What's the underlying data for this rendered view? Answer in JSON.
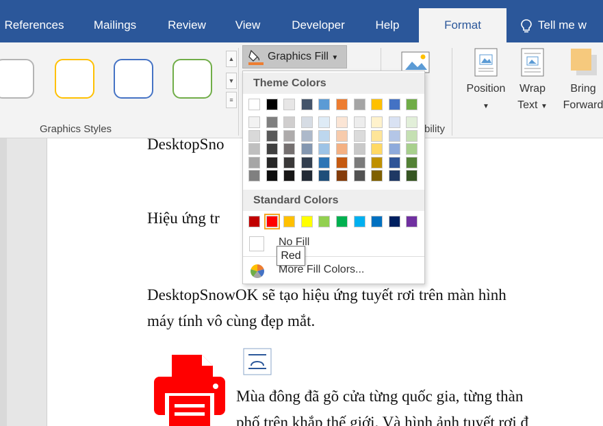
{
  "tabs": [
    {
      "label": "References"
    },
    {
      "label": "Mailings"
    },
    {
      "label": "Review"
    },
    {
      "label": "View"
    },
    {
      "label": "Developer"
    },
    {
      "label": "Help"
    },
    {
      "label": "Format"
    }
  ],
  "tell_me": "Tell me w",
  "ribbon": {
    "graphics_styles_label": "Graphics Styles",
    "graphics_fill_label": "Graphics Fill",
    "position_label": "Position",
    "wrap_text_label1": "Wrap",
    "wrap_text_label2": "Text",
    "bring_forward_label1": "Bring",
    "bring_forward_label2": "Forward",
    "accessibility_fragment": "bility",
    "shape_style_colors": [
      "#b4b4b4",
      "#ffc000",
      "#4472c4",
      "#70ad47"
    ]
  },
  "dropdown": {
    "theme_colors_heading": "Theme Colors",
    "standard_colors_heading": "Standard Colors",
    "no_fill_label": "No Fill",
    "more_fill_label": "More Fill Colors...",
    "theme_top_row": [
      "#ffffff",
      "#000000",
      "#e7e6e6",
      "#44546a",
      "#5b9bd5",
      "#ed7d31",
      "#a5a5a5",
      "#ffc000",
      "#4472c4",
      "#70ad47"
    ],
    "theme_shades": [
      [
        "#f2f2f2",
        "#d9d9d9",
        "#bfbfbf",
        "#a6a6a6",
        "#808080"
      ],
      [
        "#7f7f7f",
        "#595959",
        "#404040",
        "#262626",
        "#0d0d0d"
      ],
      [
        "#d0cece",
        "#aeabab",
        "#757070",
        "#3a3838",
        "#171616"
      ],
      [
        "#d6dce4",
        "#adb9ca",
        "#8497b0",
        "#333f4f",
        "#222a35"
      ],
      [
        "#deebf6",
        "#bdd7ee",
        "#9dc3e6",
        "#2e75b5",
        "#1f4e79"
      ],
      [
        "#fbe5d5",
        "#f7cbac",
        "#f4b183",
        "#c55a11",
        "#843c0b"
      ],
      [
        "#ededed",
        "#dbdbdb",
        "#c9c9c9",
        "#7b7b7b",
        "#525252"
      ],
      [
        "#fff2cc",
        "#fee599",
        "#ffd965",
        "#bf9000",
        "#7f6000"
      ],
      [
        "#d9e2f3",
        "#b4c6e7",
        "#8eaadb",
        "#2f5496",
        "#1f3864"
      ],
      [
        "#e2efd9",
        "#c5e0b3",
        "#a8d08d",
        "#538135",
        "#375623"
      ]
    ],
    "standard_colors": [
      "#c00000",
      "#ff0000",
      "#ffc000",
      "#ffff00",
      "#92d050",
      "#00b050",
      "#00b0f0",
      "#0070c0",
      "#002060",
      "#7030a0"
    ],
    "selected_standard_index": 1
  },
  "tooltip": "Red",
  "document": {
    "line1": "DesktopSno",
    "line2": "Hiệu ứng tr",
    "line3": "DesktopSnowOK sẽ tạo hiệu ứng tuyết rơi trên màn hình",
    "line4": "máy tính vô cùng đẹp mắt.",
    "line5": "Mùa đông đã gõ cửa từng quốc gia, từng thàn",
    "line6": "phố trên khắp thế giới. Và hình ảnh tuyết rơi đ"
  },
  "colors": {
    "tab_bar": "#2b579a",
    "printer_icon": "#ff0000"
  }
}
